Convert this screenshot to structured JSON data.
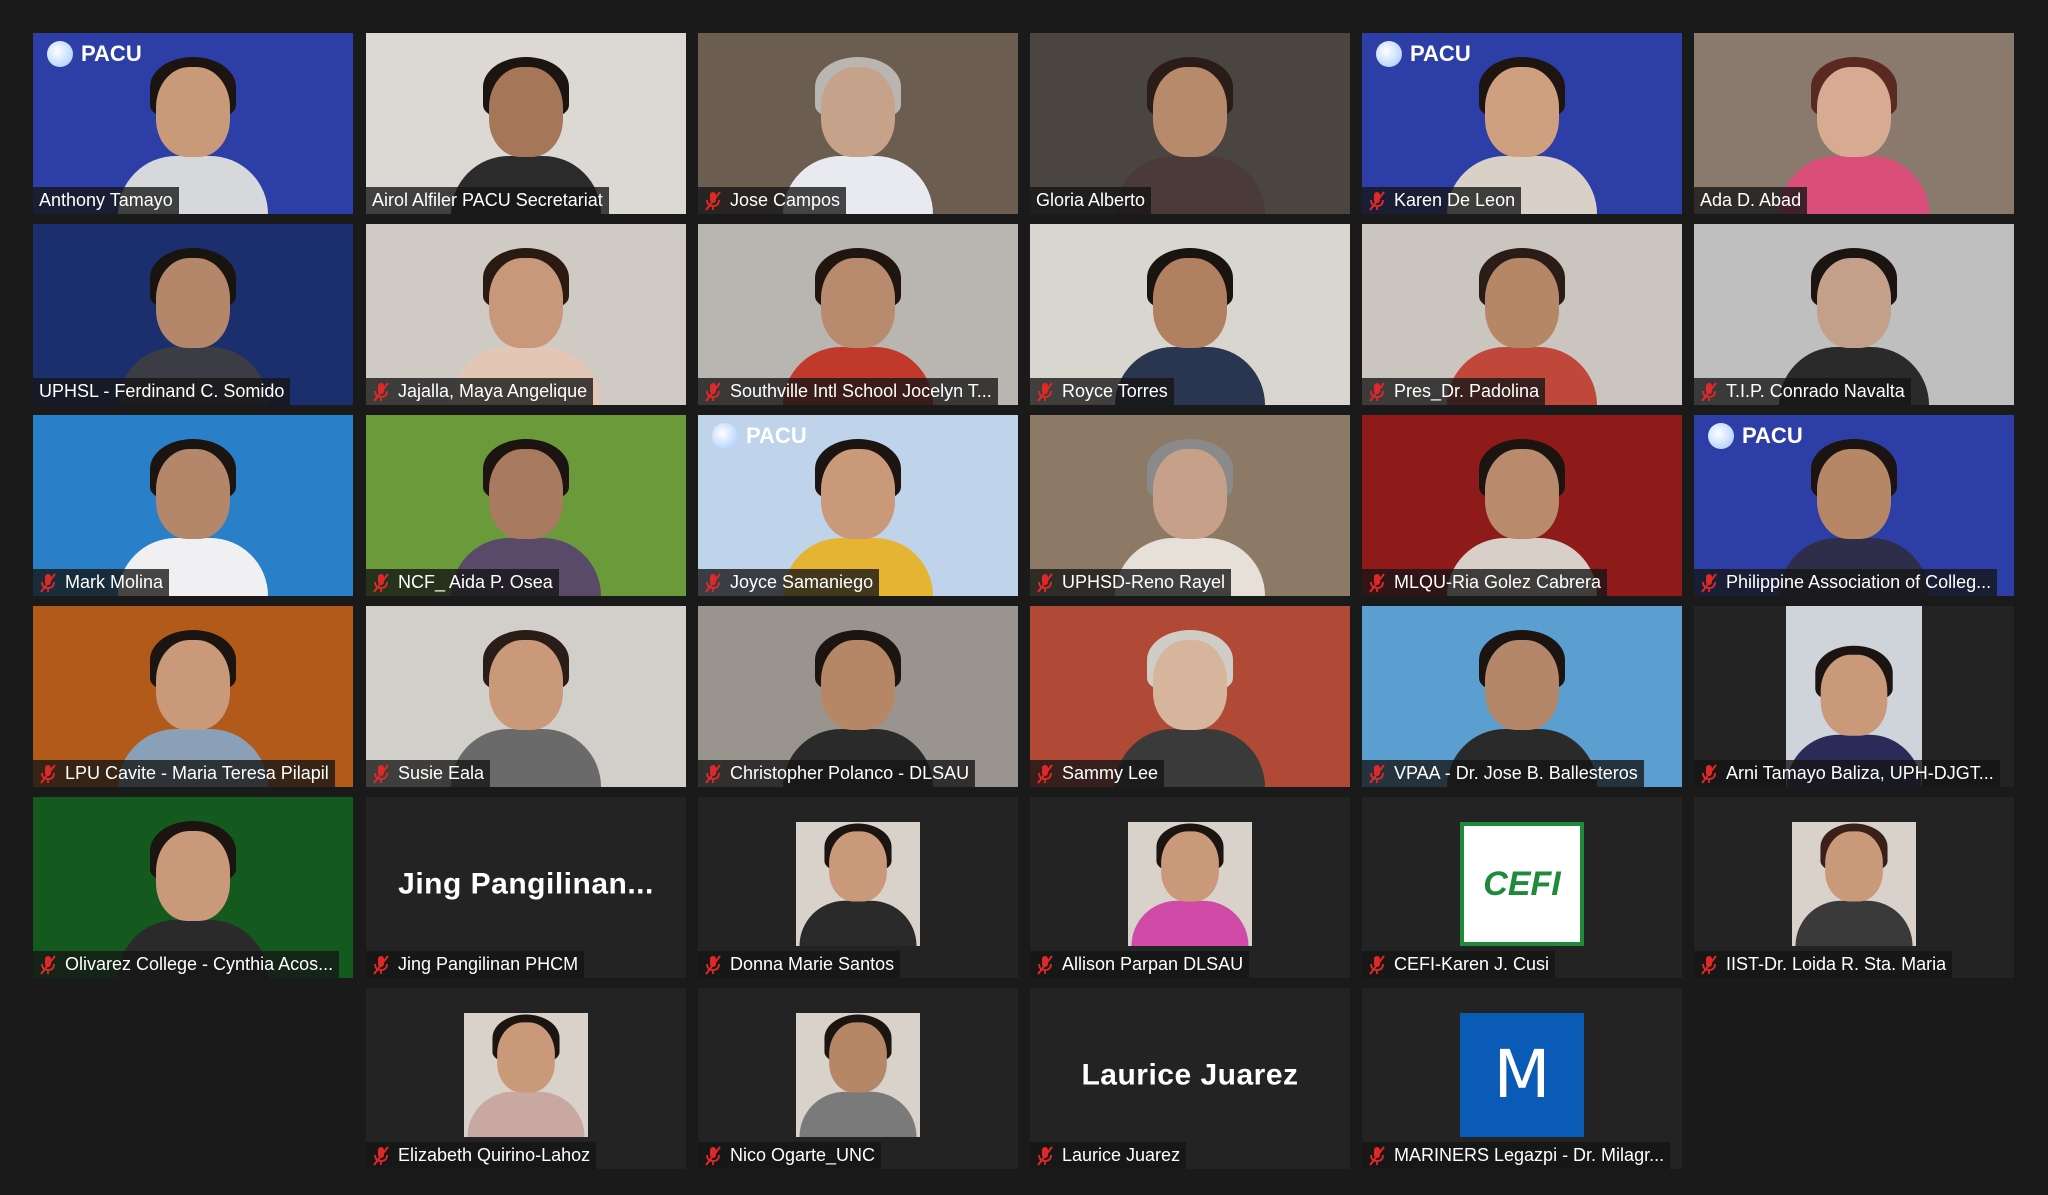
{
  "participants": [
    {
      "name": "Anthony Tamayo",
      "muted": false,
      "bg": "#2d3fa6",
      "brand": "PACU",
      "skin": "#c99a7a",
      "hair": "#1b1410",
      "shirt": "#d6d8dc"
    },
    {
      "name": "Airol Alfiler PACU Secretariat",
      "muted": false,
      "active": true,
      "bg": "#dcd9d4",
      "skin": "#a57658",
      "hair": "#1b1410",
      "shirt": "#2b2b2b"
    },
    {
      "name": "Jose Campos",
      "muted": true,
      "bg": "#6b5d50",
      "skin": "#c7a28a",
      "hair": "#b9b5b0",
      "shirt": "#e8eaf0"
    },
    {
      "name": "Gloria Alberto",
      "muted": false,
      "bg": "#4a4540",
      "skin": "#b88a6c",
      "hair": "#2a1c16",
      "shirt": "#4a3a3a"
    },
    {
      "name": "Karen De Leon",
      "muted": true,
      "bg": "#2d3fa6",
      "brand": "PACU",
      "skin": "#cfa080",
      "hair": "#1f1510",
      "shirt": "#d9d0c8"
    },
    {
      "name": "Ada D. Abad",
      "muted": false,
      "bg": "#8a7a6e",
      "skin": "#d7ab92",
      "hair": "#5a2a22",
      "shirt": "#d94f7a"
    },
    {
      "name": "UPHSL - Ferdinand C. Somido",
      "muted": false,
      "bg": "#1b2e6e",
      "skin": "#b5876a",
      "hair": "#1a1410",
      "shirt": "#3c3c44"
    },
    {
      "name": "Jajalla, Maya Angelique",
      "muted": true,
      "bg": "#cfcac4",
      "skin": "#c9987a",
      "hair": "#2a1a12",
      "shirt": "#e4c6b4"
    },
    {
      "name": "Southville Intl School Jocelyn T...",
      "muted": true,
      "bg": "#b9b6b2",
      "skin": "#b98b6e",
      "hair": "#1f1610",
      "shirt": "#c0392b"
    },
    {
      "name": "Royce Torres",
      "muted": true,
      "bg": "#d9d6cf",
      "skin": "#b08060",
      "hair": "#1a1410",
      "shirt": "#2a3550"
    },
    {
      "name": "Pres_Dr. Padolina",
      "muted": true,
      "bg": "#cac5be",
      "skin": "#b58767",
      "hair": "#2a1c16",
      "shirt": "#c0483a"
    },
    {
      "name": "T.I.P. Conrado Navalta",
      "muted": true,
      "bg": "#bfbfbf",
      "skin": "#c4a08a",
      "hair": "#1b1410",
      "shirt": "#2a2a2a"
    },
    {
      "name": "Mark Molina",
      "muted": true,
      "bg": "#2a7fc9",
      "skin": "#b5876a",
      "hair": "#1b1410",
      "shirt": "#f0f0f2"
    },
    {
      "name": "NCF_ Aida P. Osea",
      "muted": true,
      "bg": "#6a9a3a",
      "skin": "#a87a60",
      "hair": "#1b1410",
      "shirt": "#5a4a6a"
    },
    {
      "name": "Joyce Samaniego",
      "muted": true,
      "bg": "#bfd3ea",
      "brand": "PACU",
      "skin": "#c9997a",
      "hair": "#1b1410",
      "shirt": "#e6b433"
    },
    {
      "name": "UPHSD-Reno Rayel",
      "muted": true,
      "bg": "#8c7a66",
      "skin": "#c7a08a",
      "hair": "#8a8a8a",
      "shirt": "#e6e0d8"
    },
    {
      "name": "MLQU-Ria Golez Cabrera",
      "muted": true,
      "bg": "#8e1a1a",
      "skin": "#b98a6c",
      "hair": "#1b1410",
      "shirt": "#d8cfc8"
    },
    {
      "name": "Philippine Association of Colleg...",
      "muted": true,
      "bg": "#2d3fa6",
      "brand": "PACU",
      "skin": "#b58767",
      "hair": "#1b1410",
      "shirt": "#2e2e4a"
    },
    {
      "name": "LPU Cavite - Maria Teresa Pilapil",
      "muted": true,
      "bg": "#b25a1a",
      "skin": "#c9997a",
      "hair": "#1b1410",
      "shirt": "#8aa0b8"
    },
    {
      "name": "Susie Eala",
      "muted": true,
      "bg": "#d2cfca",
      "skin": "#c9997a",
      "hair": "#2a1c16",
      "shirt": "#6a6a6a"
    },
    {
      "name": "Christopher Polanco - DLSAU",
      "muted": true,
      "bg": "#9a948e",
      "skin": "#b58767",
      "hair": "#1b1410",
      "shirt": "#2a2a2a"
    },
    {
      "name": "Sammy Lee",
      "muted": true,
      "bg": "#b04a36",
      "skin": "#d7b59c",
      "hair": "#d0ccc6",
      "shirt": "#3a3a3a"
    },
    {
      "name": "VPAA - Dr. Jose B. Ballesteros",
      "muted": true,
      "bg": "#5a9fd0",
      "skin": "#b5876a",
      "hair": "#1b1410",
      "shirt": "#2a2a2a"
    },
    {
      "name": "Arni Tamayo Baliza, UPH-DJGT...",
      "muted": true,
      "bg": "#232323",
      "skin": "#c9997a",
      "hair": "#1b1410",
      "shirt": "#2b2b5a"
    },
    {
      "name": "Olivarez College - Cynthia Acos...",
      "muted": true,
      "bg": "#145a1e",
      "skin": "#c9997a",
      "hair": "#1b1410",
      "shirt": "#2a2a2a"
    },
    {
      "name": "Jing  Pangilinan PHCM",
      "muted": true,
      "bg": "#232323",
      "display": "Jing   Pangilinan..."
    },
    {
      "name": "Donna Marie Santos",
      "muted": true,
      "bg": "#232323",
      "skin": "#c9997a",
      "hair": "#1b1410",
      "shirt": "#2a2a2a"
    },
    {
      "name": "Allison Parpan DLSAU",
      "muted": true,
      "bg": "#232323",
      "skin": "#c9997a",
      "hair": "#1b1410",
      "shirt": "#d04aa8"
    },
    {
      "name": "CEFI-Karen J. Cusi",
      "muted": true,
      "bg": "#232323",
      "logo": "CEFI"
    },
    {
      "name": "IIST-Dr. Loida R. Sta. Maria",
      "muted": true,
      "bg": "#232323",
      "skin": "#c9997a",
      "hair": "#3a2018",
      "shirt": "#3a3a3a"
    },
    {
      "name": "Elizabeth Quirino-Lahoz",
      "muted": true,
      "bg": "#232323",
      "skin": "#c9997a",
      "hair": "#1b1410",
      "shirt": "#c8a8a0"
    },
    {
      "name": "Nico Ogarte_UNC",
      "muted": true,
      "bg": "#232323",
      "skin": "#b58767",
      "hair": "#1b1410",
      "shirt": "#7a7a7a"
    },
    {
      "name": "Laurice Juarez",
      "muted": true,
      "bg": "#232323",
      "display": "Laurice Juarez"
    },
    {
      "name": "MARINERS Legazpi - Dr. Milagr...",
      "muted": true,
      "bg": "#232323",
      "letter": "M"
    }
  ]
}
